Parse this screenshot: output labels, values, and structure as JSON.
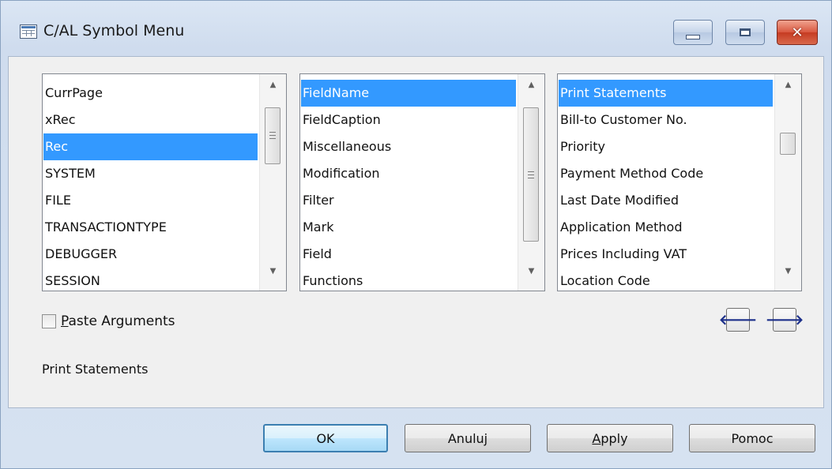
{
  "window": {
    "title": "C/AL Symbol Menu"
  },
  "lists": {
    "variables": {
      "items": [
        "CurrPage",
        "xRec",
        "Rec",
        "SYSTEM",
        "FILE",
        "TRANSACTIONTYPE",
        "DEBUGGER",
        "SESSION"
      ],
      "selected": "Rec"
    },
    "categories": {
      "items": [
        "FieldName",
        "FieldCaption",
        "Miscellaneous",
        "Modification",
        "Filter",
        "Mark",
        "Field",
        "Functions"
      ],
      "selected": "FieldName"
    },
    "symbols": {
      "items": [
        "Print Statements",
        "Bill-to Customer No.",
        "Priority",
        "Payment Method Code",
        "Last Date Modified",
        "Application Method",
        "Prices Including VAT",
        "Location Code"
      ],
      "selected": "Print Statements"
    }
  },
  "paste_arguments": {
    "label_first": "P",
    "label_rest": "aste Arguments",
    "checked": false
  },
  "status_text": "Print Statements",
  "buttons": {
    "ok": "OK",
    "cancel": "Anuluj",
    "apply_first": "A",
    "apply_rest": "pply",
    "help": "Pomoc"
  },
  "icons": {
    "title": "table-icon",
    "minimize": "minimize-icon",
    "maximize": "maximize-icon",
    "close": "close-icon",
    "nav_left": "arrow-left-icon",
    "nav_right": "arrow-right-icon"
  }
}
